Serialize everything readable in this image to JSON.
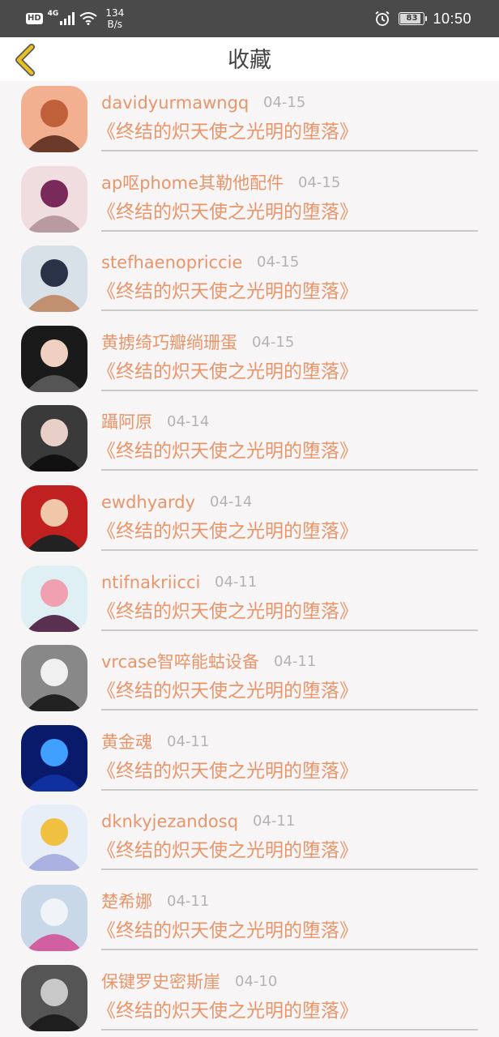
{
  "status_bar": {
    "hd": "HD",
    "network": "4G",
    "speed_value": "134",
    "speed_unit": "B/s",
    "battery": "83",
    "time": "10:50"
  },
  "header": {
    "title": "收藏",
    "back_icon": "chevron-left-icon",
    "accent_color": "#e8c020"
  },
  "colors": {
    "text_accent": "#e8956a",
    "date_gray": "#b3b3b3"
  },
  "favorites": [
    {
      "name": "davidyurmawngq",
      "date": "04-15",
      "book": "《终结的炽天使之光明的堕落》"
    },
    {
      "name": "ap呕phome其勒他配件",
      "date": "04-15",
      "book": "《终结的炽天使之光明的堕落》"
    },
    {
      "name": "stefhaenopriccie",
      "date": "04-15",
      "book": "《终结的炽天使之光明的堕落》"
    },
    {
      "name": "黄掳绮巧瓣绱珊蛋",
      "date": "04-15",
      "book": "《终结的炽天使之光明的堕落》"
    },
    {
      "name": "躡阿原",
      "date": "04-14",
      "book": "《终结的炽天使之光明的堕落》"
    },
    {
      "name": "ewdhyardy",
      "date": "04-14",
      "book": "《终结的炽天使之光明的堕落》"
    },
    {
      "name": "ntifnakriicci",
      "date": "04-11",
      "book": "《终结的炽天使之光明的堕落》"
    },
    {
      "name": "vrcase智啐能蛄设备",
      "date": "04-11",
      "book": "《终结的炽天使之光明的堕落》"
    },
    {
      "name": "黄金魂",
      "date": "04-11",
      "book": "《终结的炽天使之光明的堕落》"
    },
    {
      "name": "dknkyjezandosq",
      "date": "04-11",
      "book": "《终结的炽天使之光明的堕落》"
    },
    {
      "name": "楚希娜",
      "date": "04-11",
      "book": "《终结的炽天使之光明的堕落》"
    },
    {
      "name": "保键罗史密斯崖",
      "date": "04-10",
      "book": "《终结的炽天使之光明的堕落》"
    }
  ]
}
